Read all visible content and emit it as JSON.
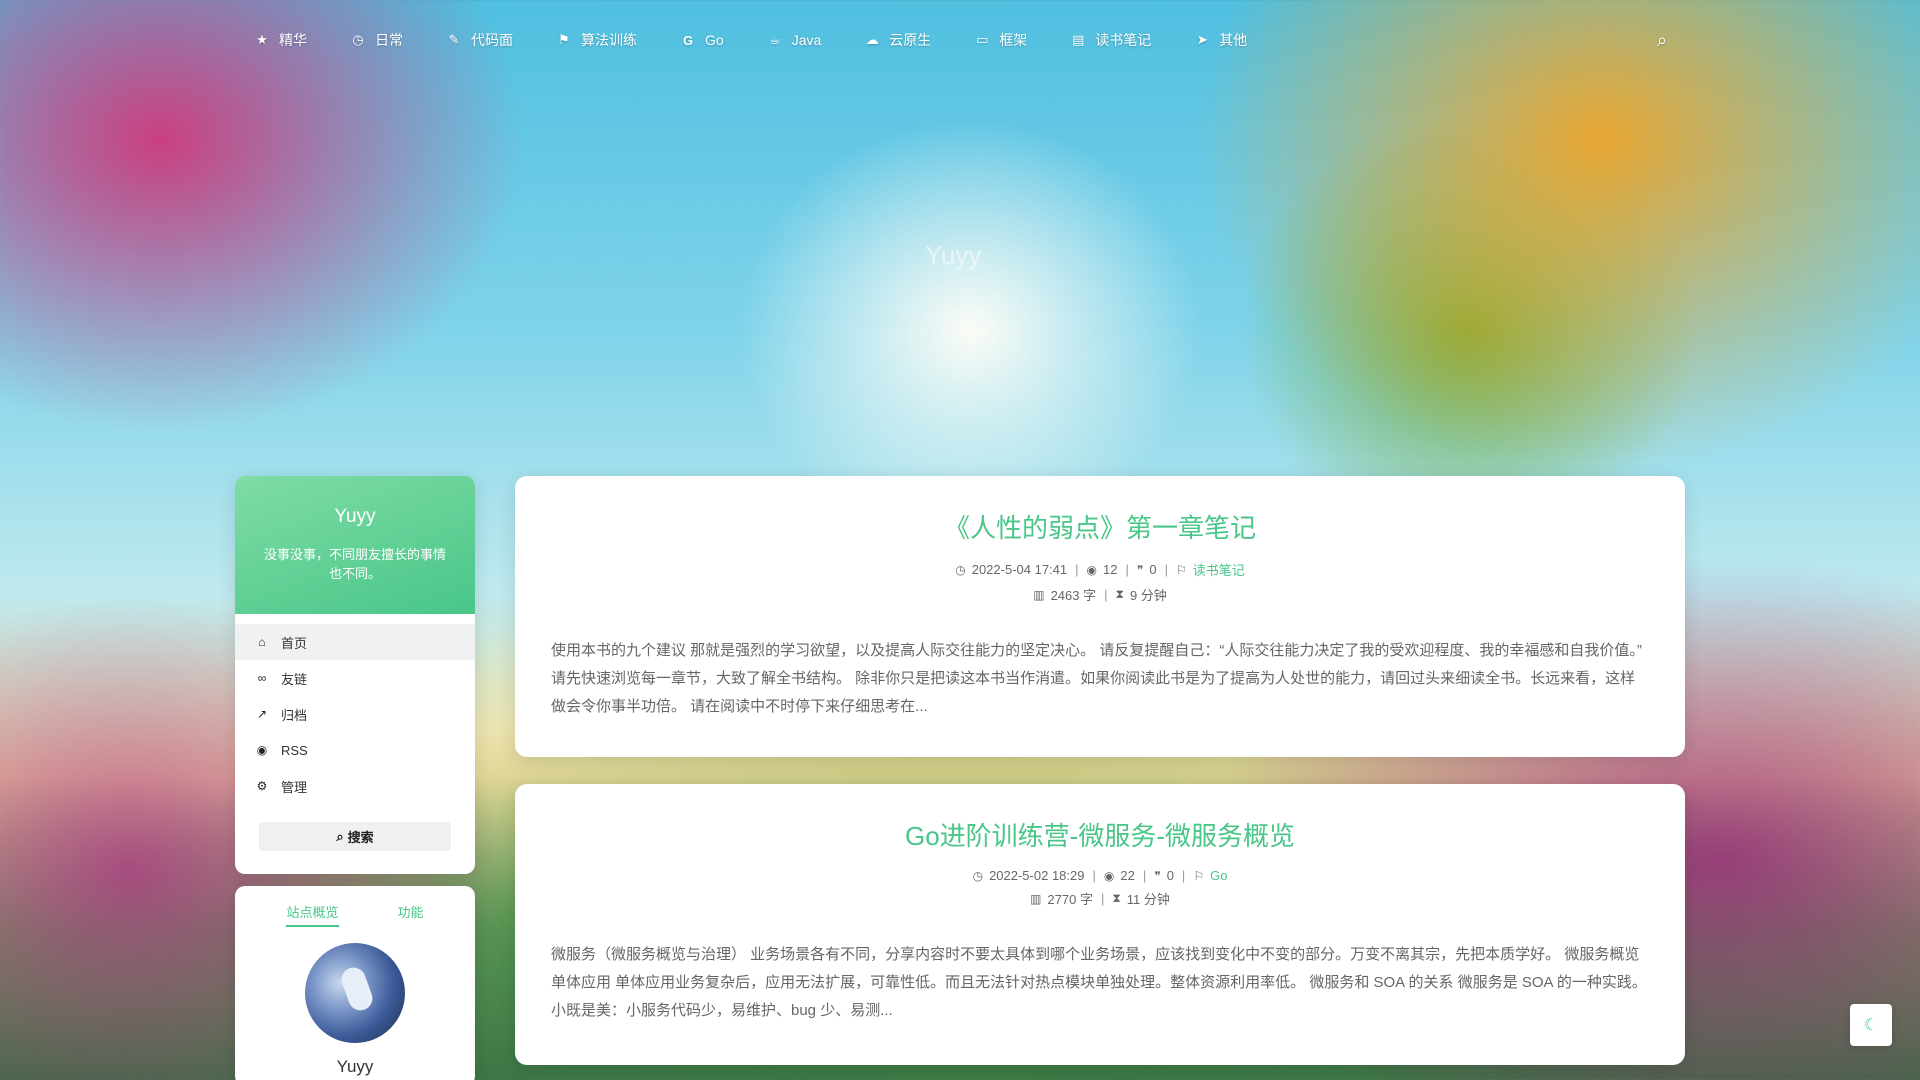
{
  "nav": {
    "items": [
      {
        "label": "精华",
        "icon": "star-icon",
        "glyph": "★"
      },
      {
        "label": "日常",
        "icon": "clock-icon",
        "glyph": "◷"
      },
      {
        "label": "代码面",
        "icon": "edit-icon",
        "glyph": "✎"
      },
      {
        "label": "算法训练",
        "icon": "flag-icon",
        "glyph": "⚑"
      },
      {
        "label": "Go",
        "icon": "google-icon",
        "glyph": "G"
      },
      {
        "label": "Java",
        "icon": "coffee-icon",
        "glyph": "☕"
      },
      {
        "label": "云原生",
        "icon": "cloud-icon",
        "glyph": "☁"
      },
      {
        "label": "框架",
        "icon": "window-icon",
        "glyph": "▭"
      },
      {
        "label": "读书笔记",
        "icon": "book-icon",
        "glyph": "▤"
      },
      {
        "label": "其他",
        "icon": "send-icon",
        "glyph": "➤"
      }
    ],
    "search_icon": "search-icon"
  },
  "site_title": "Yuyy",
  "profile": {
    "name": "Yuyy",
    "description": "没事没事，不同朋友擅长的事情也不同。",
    "menu": [
      {
        "label": "首页",
        "icon": "home-icon",
        "glyph": "⌂"
      },
      {
        "label": "友链",
        "icon": "link-icon",
        "glyph": "∞"
      },
      {
        "label": "归档",
        "icon": "chart-line-icon",
        "glyph": "↗"
      },
      {
        "label": "RSS",
        "icon": "rss-icon",
        "glyph": "◉"
      },
      {
        "label": "管理",
        "icon": "gear-icon",
        "glyph": "⚙"
      }
    ],
    "search_label": "搜索"
  },
  "stats": {
    "tabs": [
      "站点概览",
      "功能"
    ],
    "name": "Yuyy"
  },
  "posts": [
    {
      "title": "《人性的弱点》第一章笔记",
      "date": "2022-5-04 17:41",
      "views": "12",
      "comments": "0",
      "category": "读书笔记",
      "words": "2463 字",
      "read_time": "9 分钟",
      "excerpt": "使用本书的九个建议 那就是强烈的学习欲望，以及提高人际交往能力的坚定决心。 请反复提醒自己：“人际交往能力决定了我的受欢迎程度、我的幸福感和自我价值。” 请先快速浏览每一章节，大致了解全书结构。 除非你只是把读这本书当作消遣。如果你阅读此书是为了提高为人处世的能力，请回过头来细读全书。长远来看，这样做会令你事半功倍。 请在阅读中不时停下来仔细思考在..."
    },
    {
      "title": "Go进阶训练营-微服务-微服务概览",
      "date": "2022-5-02 18:29",
      "views": "22",
      "comments": "0",
      "category": "Go",
      "words": "2770 字",
      "read_time": "11 分钟",
      "excerpt": "微服务（微服务概览与治理） 业务场景各有不同，分享内容时不要太具体到哪个业务场景，应该找到变化中不变的部分。万变不离其宗，先把本质学好。 微服务概览 单体应用 单体应用业务复杂后，应用无法扩展，可靠性低。而且无法针对热点模块单独处理。整体资源利用率低。 微服务和 SOA 的关系 微服务是 SOA 的一种实践。 小既是美：小服务代码少，易维护、bug 少、易测..."
    }
  ],
  "dark_mode_icon": "moon-icon",
  "colors": {
    "accent": "#49c688",
    "accent_light": "#7fdca5"
  }
}
